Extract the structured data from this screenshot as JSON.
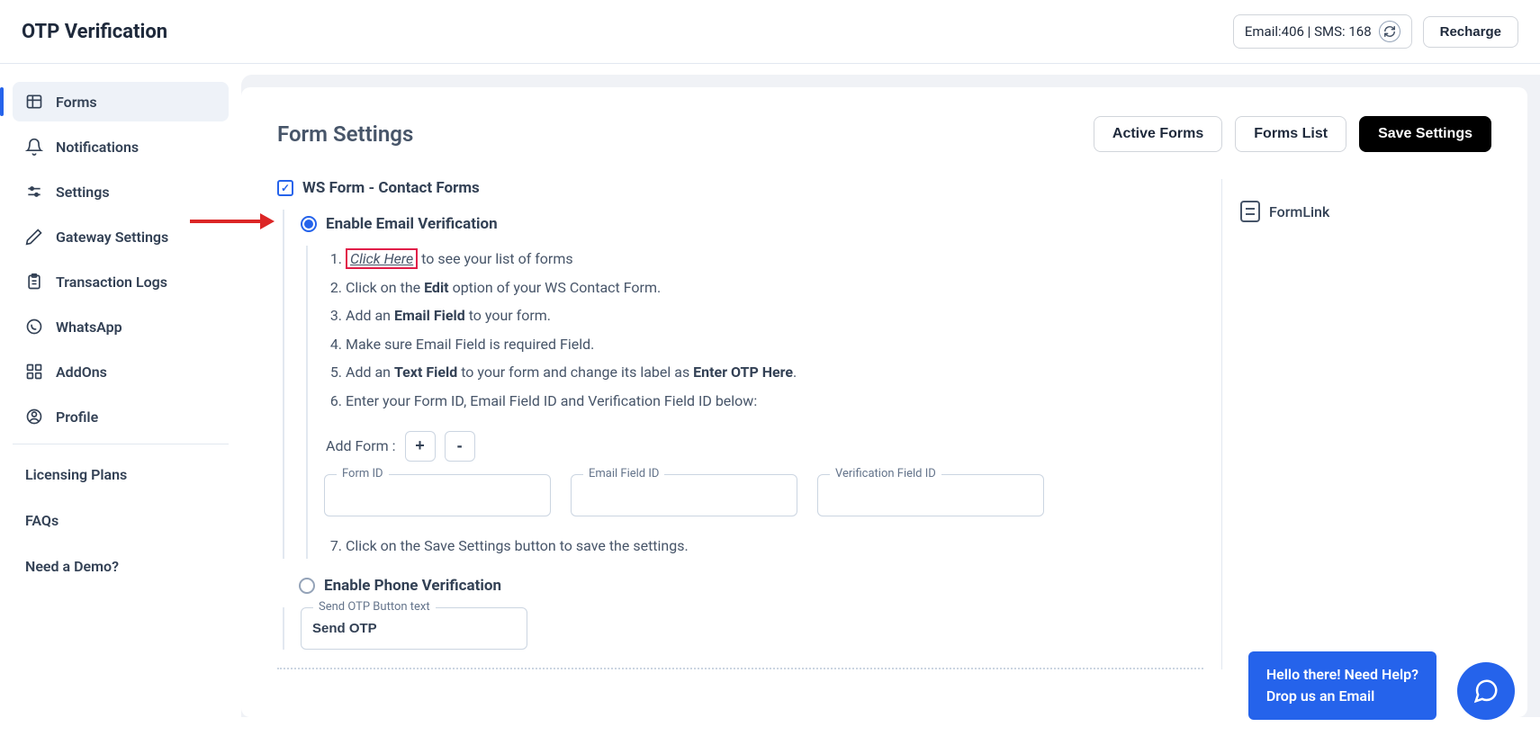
{
  "header": {
    "title": "OTP Verification",
    "credits_email_label": "Email:",
    "credits_email_value": "406",
    "credits_separator": " | ",
    "credits_sms_label": "SMS: ",
    "credits_sms_value": "168",
    "recharge_label": "Recharge"
  },
  "sidebar": {
    "items": [
      {
        "label": "Forms",
        "icon": "window-icon",
        "active": true
      },
      {
        "label": "Notifications",
        "icon": "bell-icon"
      },
      {
        "label": "Settings",
        "icon": "sliders-icon"
      },
      {
        "label": "Gateway Settings",
        "icon": "pen-icon"
      },
      {
        "label": "Transaction Logs",
        "icon": "clipboard-icon"
      },
      {
        "label": "WhatsApp",
        "icon": "whatsapp-icon"
      },
      {
        "label": "AddOns",
        "icon": "grid-icon"
      },
      {
        "label": "Profile",
        "icon": "user-icon"
      }
    ],
    "links": [
      {
        "label": "Licensing Plans"
      },
      {
        "label": "FAQs"
      },
      {
        "label": "Need a Demo?"
      }
    ]
  },
  "main": {
    "title": "Form Settings",
    "actions": {
      "active_forms": "Active Forms",
      "forms_list": "Forms List",
      "save_settings": "Save Settings"
    },
    "checkbox_label": "WS Form - Contact Forms",
    "radio_email_label": "Enable Email Verification",
    "radio_phone_label": "Enable Phone Verification",
    "instructions": {
      "i1_prefix": "",
      "click_here": "Click Here",
      "i1_suffix": " to see your list of forms",
      "i2_prefix": "Click on the ",
      "i2_bold": "Edit",
      "i2_suffix": " option of your WS Contact Form.",
      "i3_prefix": "Add an ",
      "i3_bold": "Email Field",
      "i3_suffix": " to your form.",
      "i4": "Make sure Email Field is required Field.",
      "i5_prefix": "Add an ",
      "i5_bold1": "Text Field",
      "i5_mid": " to your form and change its label as ",
      "i5_bold2": "Enter OTP Here",
      "i5_suffix": ".",
      "i6": "Enter your Form ID, Email Field ID and Verification Field ID below:",
      "i7": "Click on the Save Settings button to save the settings."
    },
    "add_form_label": "Add Form :",
    "add_form_plus": "+",
    "add_form_minus": "-",
    "fields": {
      "form_id_label": "Form ID",
      "form_id_value": "",
      "email_field_label": "Email Field ID",
      "email_field_value": "",
      "verification_field_label": "Verification Field ID",
      "verification_field_value": ""
    },
    "send_otp_label": "Send OTP Button text",
    "send_otp_value": "Send OTP",
    "formlink_label": "FormLink"
  },
  "help": {
    "line1": "Hello there! Need Help?",
    "line2": "Drop us an Email"
  }
}
